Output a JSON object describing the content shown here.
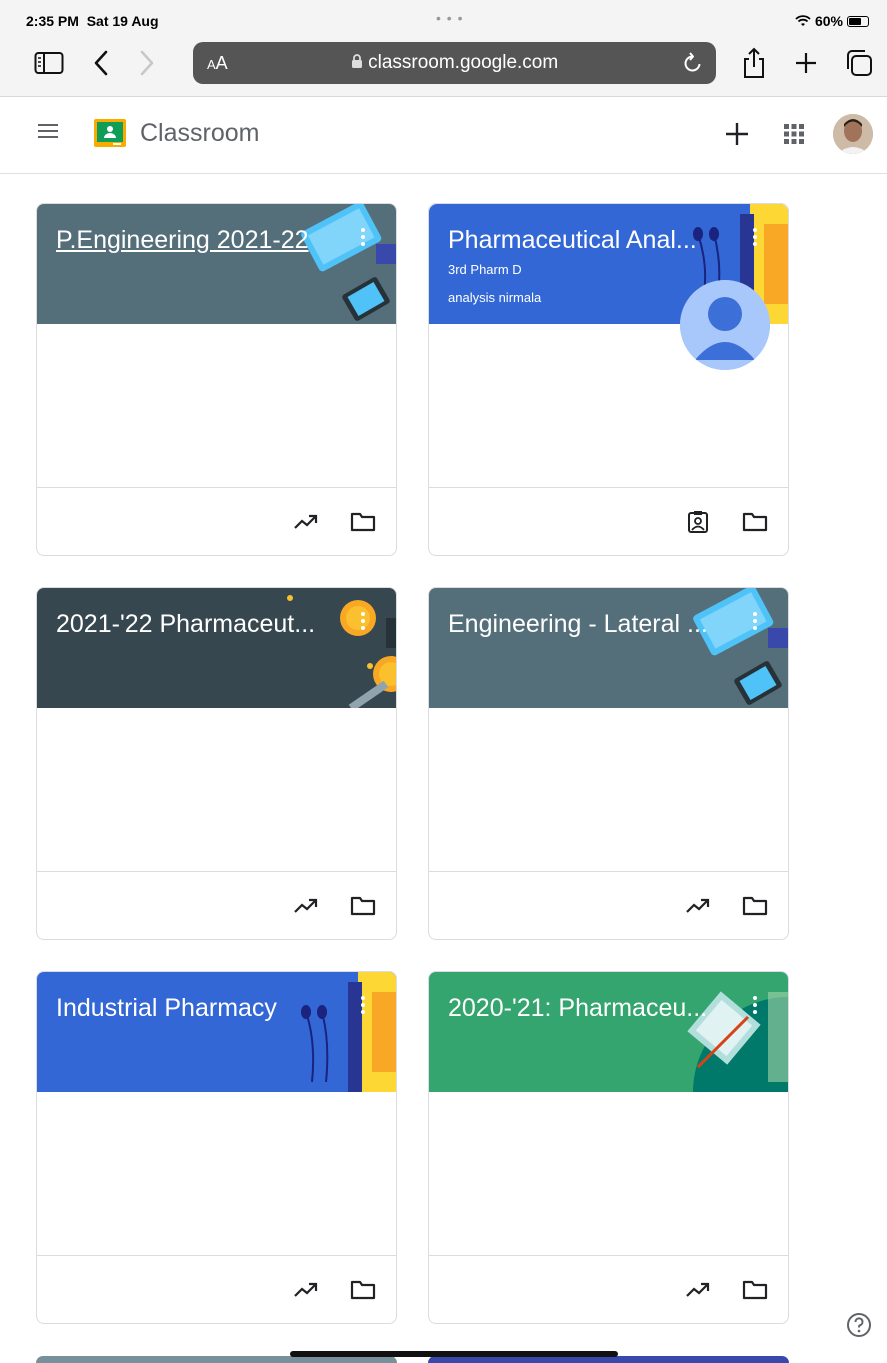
{
  "status": {
    "time": "2:35 PM",
    "date": "Sat 19 Aug",
    "battery": "60%"
  },
  "browser": {
    "aa_small": "A",
    "aa_large": "A",
    "url": "classroom.google.com"
  },
  "app": {
    "title": "Classroom"
  },
  "classes": [
    {
      "name": "P.Engineering 2021-22",
      "section": "",
      "teacher": "",
      "color": "#546e7a",
      "theme": "tech",
      "footer": "analytics"
    },
    {
      "name": "Pharmaceutical Anal...",
      "section": "3rd Pharm D",
      "teacher": "analysis nirmala",
      "color": "#3367d6",
      "theme": "books",
      "footer": "profile"
    },
    {
      "name": "2021-'22 Pharmaceut...",
      "section": "",
      "teacher": "",
      "color": "#37474f",
      "theme": "coins",
      "footer": "analytics"
    },
    {
      "name": "Engineering - Lateral ...",
      "section": "",
      "teacher": "",
      "color": "#546e7a",
      "theme": "tech",
      "footer": "analytics"
    },
    {
      "name": "Industrial Pharmacy",
      "section": "",
      "teacher": "",
      "color": "#3367d6",
      "theme": "books",
      "footer": "analytics"
    },
    {
      "name": "2020-'21: Pharmaceu...",
      "section": "",
      "teacher": "",
      "color": "#34a56f",
      "theme": "notes",
      "footer": "analytics"
    }
  ],
  "icons": {
    "sidebar": "sidebar-icon",
    "back": "back-icon",
    "forward": "forward-icon",
    "lock": "lock-icon",
    "reload": "reload-icon",
    "share": "share-icon",
    "new_tab": "plus-icon",
    "tabs": "tabs-icon",
    "menu": "menu-icon",
    "add": "add-icon",
    "apps": "apps-grid-icon",
    "help": "help-icon"
  }
}
